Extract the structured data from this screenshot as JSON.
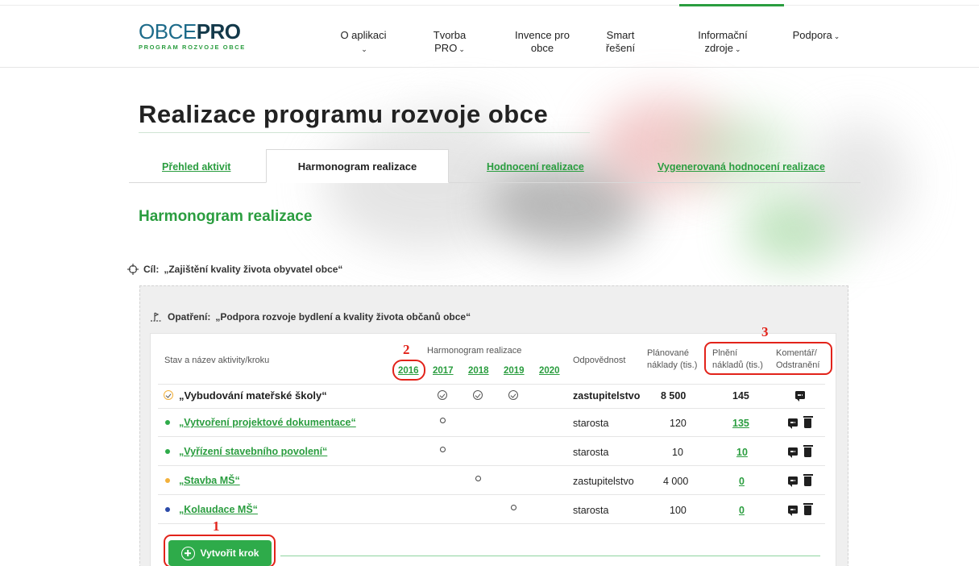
{
  "colors": {
    "brand_green": "#2a9d3f",
    "annotation_red": "#e2231a",
    "logo_blue": "#1d6b8a"
  },
  "logo": {
    "part_light": "OBCE",
    "part_bold": "PRO",
    "subtitle": "PROGRAM ROZVOJE OBCE"
  },
  "nav": [
    {
      "label": "O aplikaci",
      "chevron": "chevron-down-icon"
    },
    {
      "label": "Tvorba PRO",
      "chevron": "chevron-down-icon"
    },
    {
      "label": "Invence pro obce"
    },
    {
      "label": "Smart řešení"
    },
    {
      "label": "Informační zdroje",
      "chevron": "chevron-down-icon"
    },
    {
      "label": "Podpora",
      "chevron": "chevron-down-icon"
    }
  ],
  "page_title": "Realizace programu rozvoje obce",
  "tabs": [
    {
      "label": "Přehled aktivit",
      "active": false
    },
    {
      "label": "Harmonogram realizace",
      "active": true
    },
    {
      "label": "Hodnocení realizace",
      "active": false
    },
    {
      "label": "Vygenerovaná hodnocení realizace",
      "active": false
    }
  ],
  "section_title": "Harmonogram realizace",
  "goal": {
    "prefix": "Cíl:",
    "text": "„Zajištění kvality života obyvatel obce“"
  },
  "measure": {
    "prefix": "Opatření:",
    "text": "„Podpora rozvoje bydlení a kvality života občanů obce“"
  },
  "table": {
    "headers": {
      "name": "Stav a název aktivity/kroku",
      "schedule": "Harmonogram realizace",
      "responsibility": "Odpovědnost",
      "planned_l1": "Plánované",
      "planned_l2": "náklady (tis.)",
      "actual_l1": "Plnění",
      "actual_l2": "nákladů (tis.)",
      "comment_l1": "Komentář/",
      "comment_l2": "Odstranění"
    },
    "years": [
      "2016",
      "2017",
      "2018",
      "2019",
      "2020"
    ],
    "activity": {
      "name": "„Vybudování mateřské školy“",
      "responsibility": "zastupitelstvo",
      "planned": "8 500",
      "actual": "145",
      "status_icon": "check-circle-icon",
      "schedule_icons": "check-circle-icon",
      "schedule_years": [
        0,
        1,
        2
      ]
    },
    "steps": [
      {
        "name": "„Vytvoření projektové dokumentace“",
        "responsibility": "starosta",
        "planned": "120",
        "actual": "135",
        "status_color": "#2eab4a",
        "year_index": 0
      },
      {
        "name": "„Vyřízení stavebního povolení“",
        "responsibility": "starosta",
        "planned": "10",
        "actual": "10",
        "status_color": "#2eab4a",
        "year_index": 0
      },
      {
        "name": "„Stavba MŠ“",
        "responsibility": "zastupitelstvo",
        "planned": "4 000",
        "actual": "0",
        "status_color": "#f3b13b",
        "year_index": 1
      },
      {
        "name": "„Kolaudace MŠ“",
        "responsibility": "starosta",
        "planned": "100",
        "actual": "0",
        "status_color": "#2b4aa8",
        "year_index": 2
      }
    ]
  },
  "create_button": {
    "label": "Vytvořit krok"
  },
  "annotations": {
    "one": "1",
    "two": "2",
    "three": "3"
  }
}
